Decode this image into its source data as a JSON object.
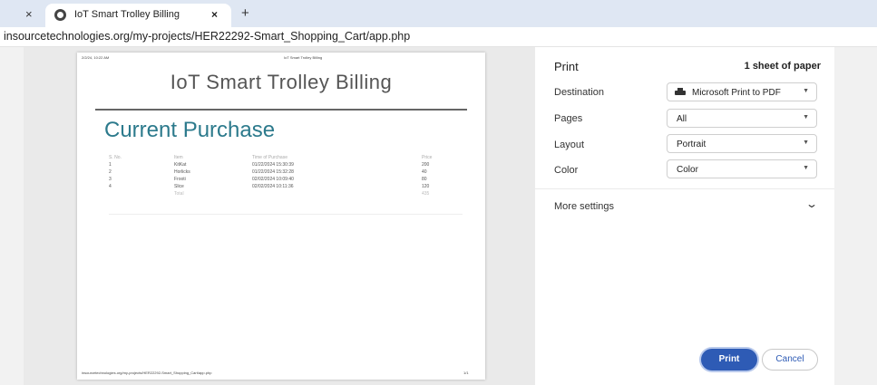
{
  "browser": {
    "tab_title": "IoT Smart Trolley Billing",
    "url": "insourcetechnologies.org/my-projects/HER22292-Smart_Shopping_Cart/app.php"
  },
  "preview": {
    "header_date": "2/2/24, 10:22 AM",
    "header_title": "IoT Smart Trolley Billing",
    "page_title": "IoT Smart Trolley Billing",
    "section_title": "Current Purchase",
    "columns": [
      "S. No.",
      "Item",
      "Time of Purchase",
      "Price"
    ],
    "rows": [
      [
        "1",
        "KitKat",
        "01/22/2024 15:30:39",
        "200"
      ],
      [
        "2",
        "Horlicks",
        "01/22/2024 15:32:28",
        "40"
      ],
      [
        "3",
        "Frooti",
        "02/02/2024 10:09:40",
        "80"
      ],
      [
        "4",
        "Slice",
        "02/02/2024 10:11:36",
        "120"
      ]
    ],
    "total_label": "Total",
    "total_value": "435",
    "footer_url": "insourcetechnologies.org/my-projects/HER22292-Smart_Shopping_Cart/app.php",
    "footer_page": "1/1"
  },
  "panel": {
    "title": "Print",
    "sheets": "1 sheet of paper",
    "destination_label": "Destination",
    "destination_value": "Microsoft Print to PDF",
    "pages_label": "Pages",
    "pages_value": "All",
    "layout_label": "Layout",
    "layout_value": "Portrait",
    "color_label": "Color",
    "color_value": "Color",
    "more_settings": "More settings",
    "print_button": "Print",
    "cancel_button": "Cancel"
  },
  "icons": {
    "close": "×",
    "new_tab": "+",
    "caret": "▼",
    "chevron": "⌄"
  },
  "colors": {
    "tab_strip": "#dfe7f3",
    "accent_button": "#2e5bb5",
    "heading_teal": "#2c7a8c"
  }
}
